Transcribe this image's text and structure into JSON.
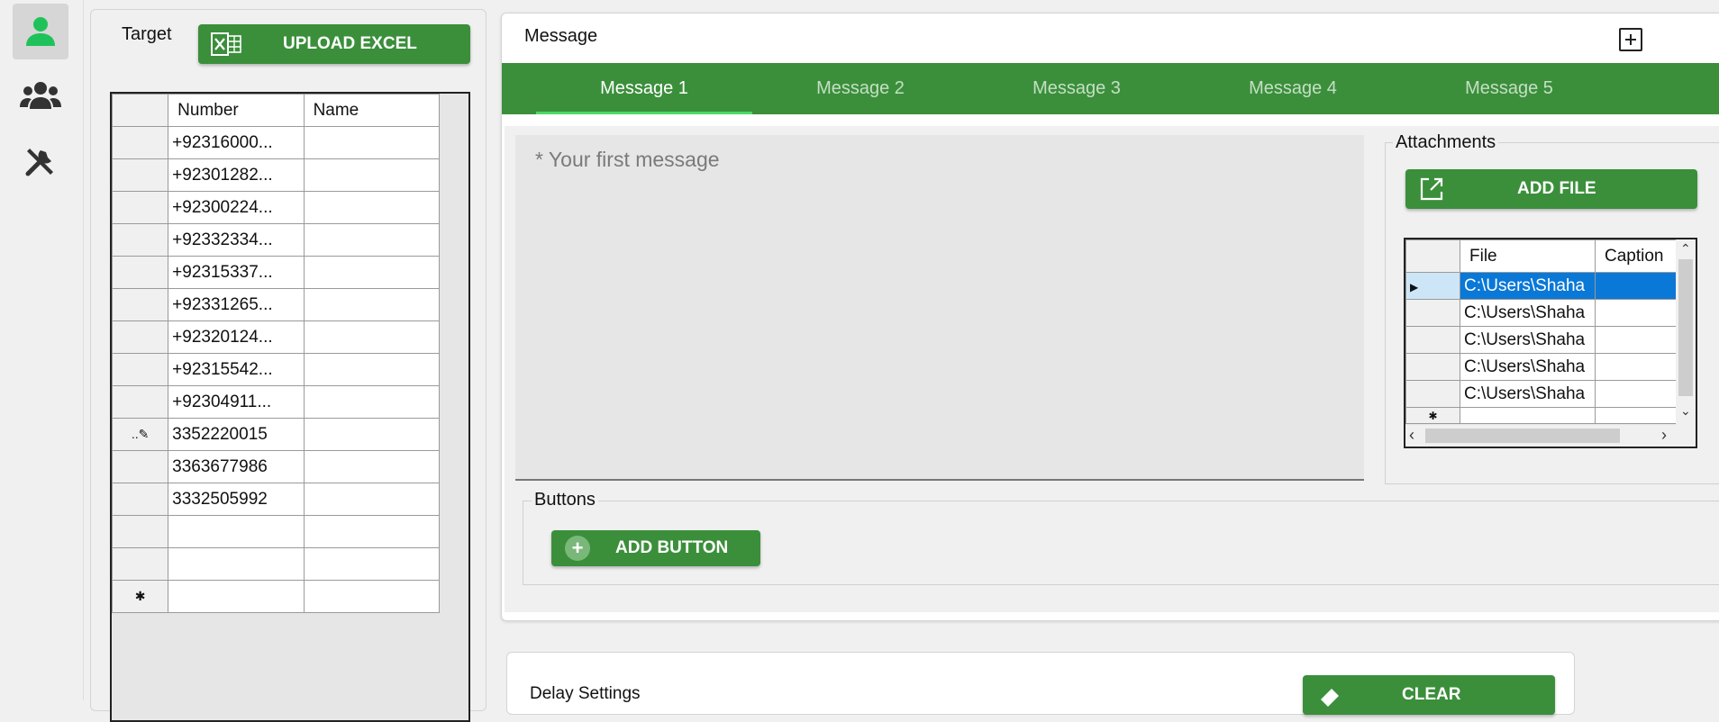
{
  "rail": {
    "items": [
      {
        "icon": "person-icon",
        "active": true
      },
      {
        "icon": "group-icon",
        "active": false
      },
      {
        "icon": "tools-icon",
        "active": false
      }
    ]
  },
  "target": {
    "label": "Target",
    "upload_label": "UPLOAD EXCEL",
    "columns": [
      "Number",
      "Name"
    ],
    "rows": [
      {
        "marker": "",
        "number": "+92316000...",
        "name": ""
      },
      {
        "marker": "",
        "number": "+92301282...",
        "name": ""
      },
      {
        "marker": "",
        "number": "+92300224...",
        "name": ""
      },
      {
        "marker": "",
        "number": "+92332334...",
        "name": ""
      },
      {
        "marker": "",
        "number": "+92315337...",
        "name": ""
      },
      {
        "marker": "",
        "number": "+92331265...",
        "name": ""
      },
      {
        "marker": "",
        "number": "+92320124...",
        "name": ""
      },
      {
        "marker": "",
        "number": "+92315542...",
        "name": ""
      },
      {
        "marker": "",
        "number": "+92304911...",
        "name": ""
      },
      {
        "marker": "edit",
        "number": "3352220015",
        "name": ""
      },
      {
        "marker": "",
        "number": "3363677986",
        "name": ""
      },
      {
        "marker": "",
        "number": "3332505992",
        "name": ""
      },
      {
        "marker": "",
        "number": "",
        "name": ""
      },
      {
        "marker": "",
        "number": "",
        "name": ""
      },
      {
        "marker": "new",
        "number": "",
        "name": ""
      }
    ]
  },
  "message": {
    "label": "Message",
    "tabs": [
      "Message 1",
      "Message 2",
      "Message 3",
      "Message 4",
      "Message 5"
    ],
    "active_tab": 0,
    "placeholder": "* Your first message"
  },
  "attachments": {
    "label": "Attachments",
    "add_label": "ADD FILE",
    "columns": [
      "File",
      "Caption"
    ],
    "rows": [
      {
        "file": "C:\\Users\\Shaha",
        "caption": ""
      },
      {
        "file": "C:\\Users\\Shaha",
        "caption": ""
      },
      {
        "file": "C:\\Users\\Shaha",
        "caption": ""
      },
      {
        "file": "C:\\Users\\Shaha",
        "caption": ""
      },
      {
        "file": "C:\\Users\\Shaha",
        "caption": ""
      }
    ]
  },
  "buttons": {
    "label": "Buttons",
    "add_label": "ADD BUTTON"
  },
  "delay": {
    "label": "Delay Settings",
    "clear_label": "CLEAR"
  },
  "colors": {
    "accent": "#3b8f3b",
    "active_icon": "#1fc25a",
    "tab_underline": "#4cd964",
    "selection": "#0a78d7"
  }
}
